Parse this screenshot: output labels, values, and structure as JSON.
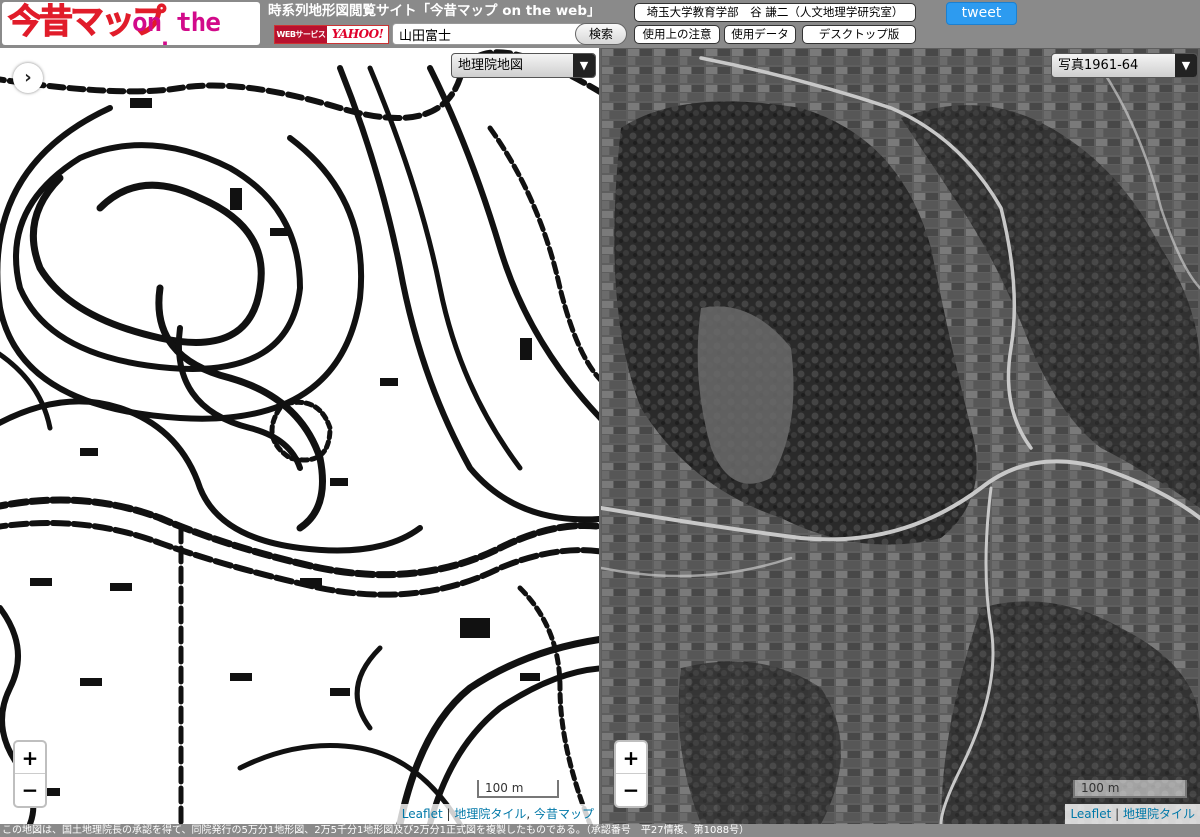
{
  "logo": {
    "jp": "今昔マップ",
    "en": "on the web"
  },
  "header": {
    "title": "時系列地形図閲覧サイト「今昔マップ on the web」",
    "yahoo_badge_web": "WEBサービス",
    "yahoo_badge_brand": "YAHOO!",
    "search_value": "山田富士",
    "search_button": "検索",
    "univ_link": "埼玉大学教育学部　谷 謙二（人文地理学研究室）",
    "notes_link": "使用上の注意",
    "data_link": "使用データ",
    "desktop_link": "デスクトップ版",
    "tweet": "tweet"
  },
  "left_map": {
    "layer": "地理院地図",
    "toggle": "›",
    "zoom_in": "+",
    "zoom_out": "−",
    "scale": "100 m",
    "attribution": {
      "leaflet": "Leaflet",
      "sep": " | ",
      "tiles": "地理院タイル",
      "comma": ", ",
      "konjaku": "今昔マップ"
    }
  },
  "right_map": {
    "layer": "写真1961-64",
    "zoom_in": "+",
    "zoom_out": "−",
    "scale": "100 m",
    "attribution": {
      "leaflet": "Leaflet",
      "sep": " | ",
      "tiles": "地理院タイル"
    }
  },
  "footer": {
    "text": "この地図は、国土地理院長の承認を得て、同院発行の5万分1地形図、2万5千分1地形図及び2万分1正式図を複製したものである。（承認番号　平27情複、第1088号）"
  },
  "colors": {
    "header_bg": "#8a8a8a",
    "tweet": "#2d9bf0",
    "logo_red": "#e11c2a",
    "logo_magenta": "#d20a8a",
    "link": "#0078a8"
  },
  "icons": {
    "dropdown": "triangle-down-icon",
    "toggle": "chevron-right-icon"
  }
}
